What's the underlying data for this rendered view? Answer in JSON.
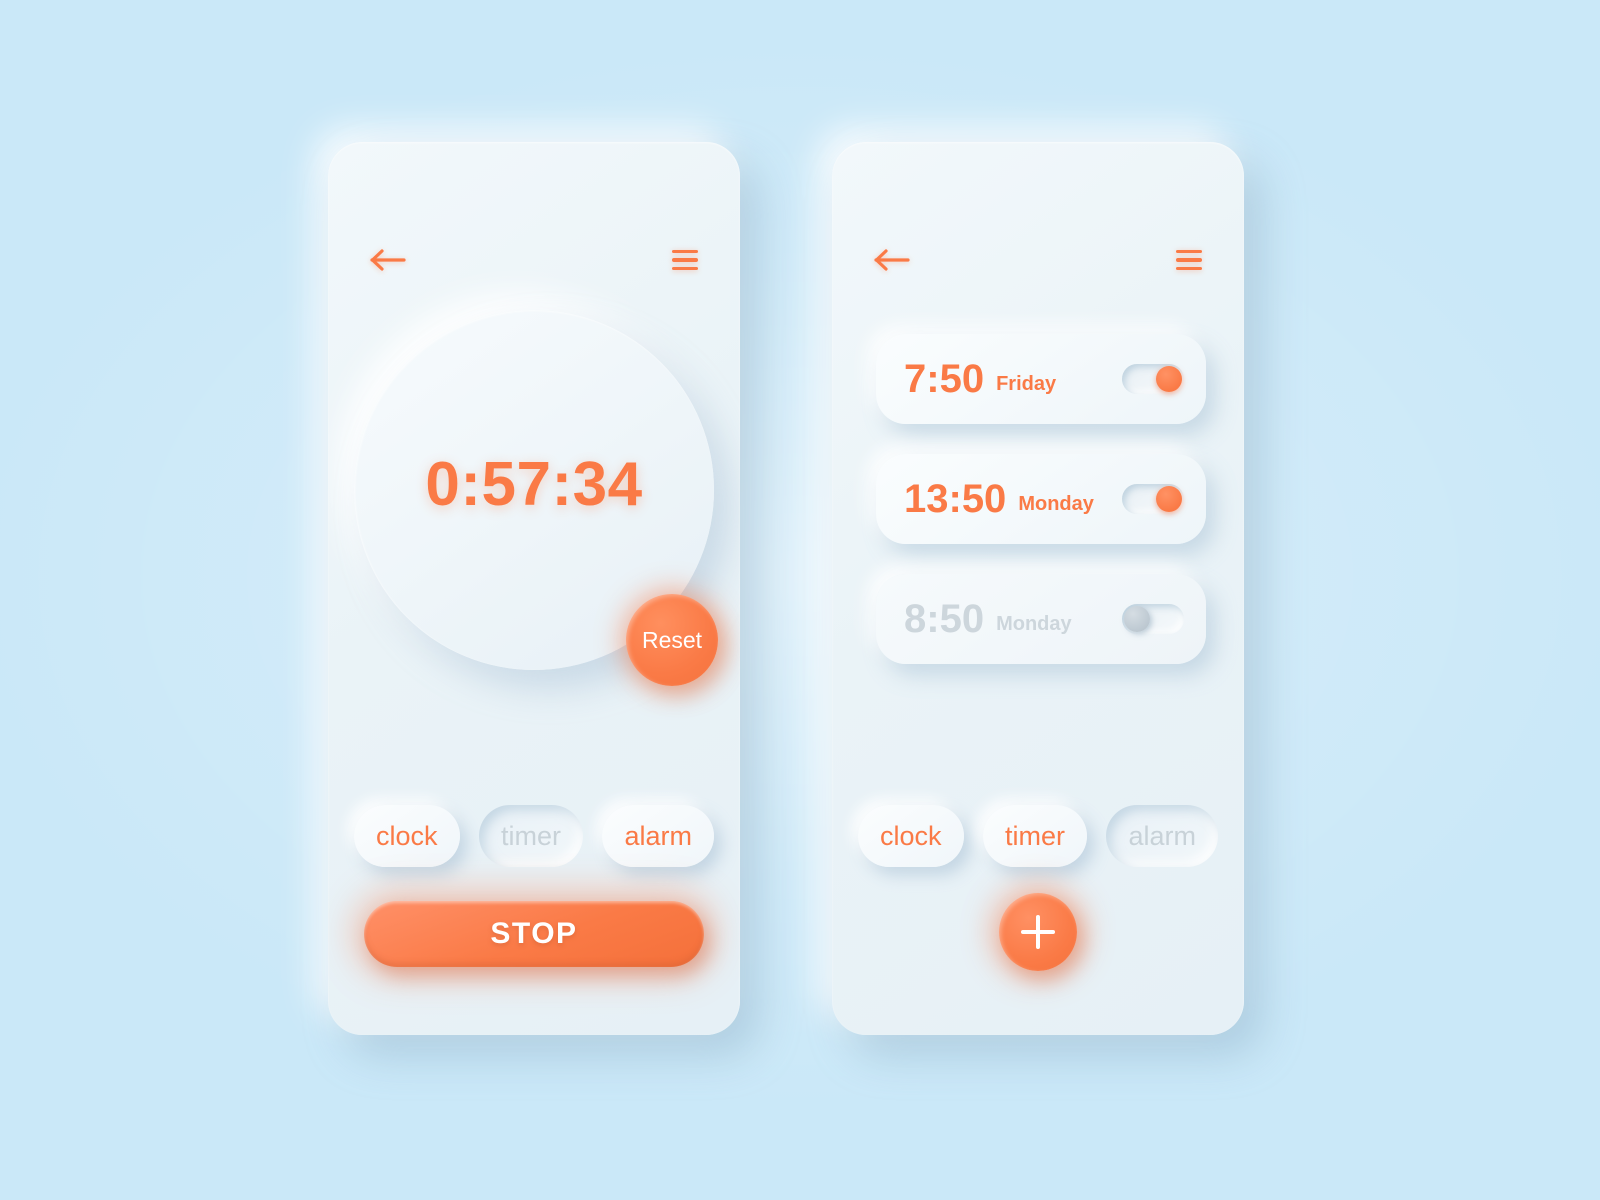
{
  "theme": {
    "background": "#cae8f8",
    "card": "#eef5f8",
    "accent": "#fa7a46",
    "muted_text": "#c8d2d8"
  },
  "screens": {
    "timer": {
      "header": {
        "back_icon": "back-arrow-icon",
        "menu_icon": "hamburger-menu-icon"
      },
      "dial": {
        "time": "0:57:34"
      },
      "reset_label": "Reset",
      "tabs": [
        {
          "label": "clock",
          "active": false
        },
        {
          "label": "timer",
          "active": true
        },
        {
          "label": "alarm",
          "active": false
        }
      ],
      "primary_action": "STOP"
    },
    "alarm": {
      "header": {
        "back_icon": "back-arrow-icon",
        "menu_icon": "hamburger-menu-icon"
      },
      "alarms": [
        {
          "time": "7:50",
          "day": "Friday",
          "enabled": true
        },
        {
          "time": "13:50",
          "day": "Monday",
          "enabled": true
        },
        {
          "time": "8:50",
          "day": "Monday",
          "enabled": false
        }
      ],
      "tabs": [
        {
          "label": "clock",
          "active": false
        },
        {
          "label": "timer",
          "active": false
        },
        {
          "label": "alarm",
          "active": true
        }
      ],
      "add_label": "+"
    }
  }
}
